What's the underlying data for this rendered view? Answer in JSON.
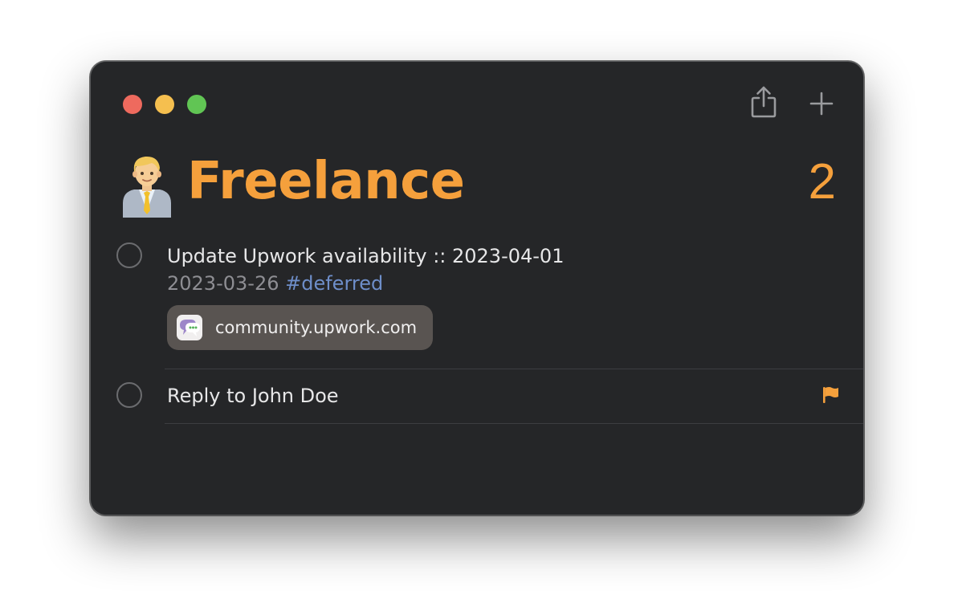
{
  "list": {
    "title": "Freelance",
    "count": "2",
    "icon": "man-office-worker-emoji",
    "accent_color": "#f5a03c"
  },
  "toolbar": {
    "share_icon": "share-icon",
    "add_icon": "plus-icon"
  },
  "reminders": [
    {
      "title": "Update Upwork availability :: 2023-04-01",
      "date": "2023-03-26",
      "tag": "#deferred",
      "link": "community.upwork.com",
      "link_icon": "chat-bubble-icon"
    },
    {
      "title": "Reply to John Doe",
      "flagged": true,
      "flag_icon": "flag-icon"
    }
  ]
}
